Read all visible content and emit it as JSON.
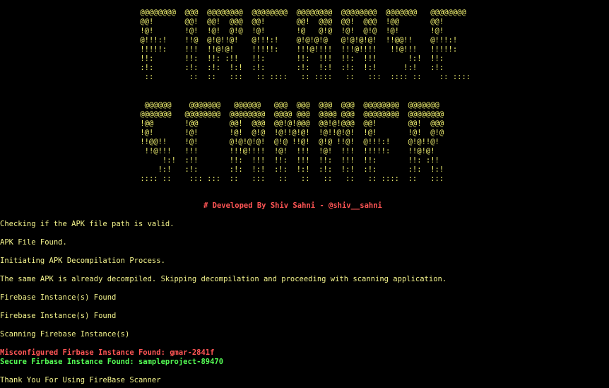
{
  "banner": {
    "block1": " @@@@@@@@  @@@  @@@@@@@@  @@@@@@@@  @@@@@@@@  @@@@@@@@  @@@@@@@   @@@@@@@@\n @@!       @@!  @@!  @@@  @@!       @@!  @@@  @@!  @@@  !@@       @@!\n !@!       !@!  !@!  @!@  !@!       !@   @!@  !@!  @!@  !@!       !@!\n @!!!:!    !!@  @!@!!@!   @!!!:!    @!@!@!@   @!@!@!@!  !!@@!!    @!!!:!\n !!!!!:    !!!  !!@!@!    !!!!!:    !!!@!!!!  !!!@!!!!   !!@!!!   !!!!!:\n !!:       !!:  !!: :!!   !!:       !!:  !!!  !!:  !!!       !:!  !!:\n :!:       :!:  :!:  !:!  :!:       :!:  !:!  :!:  !:!      !:!   :!:\n  ::        ::  ::   :::   :: ::::   :: ::::   ::   :::  :::: ::    :: ::::",
    "block2": "  @@@@@@    @@@@@@@   @@@@@@   @@@  @@@  @@@  @@@  @@@@@@@@  @@@@@@@\n @@@@@@@   @@@@@@@@  @@@@@@@@  @@@@ @@@  @@@@ @@@  @@@@@@@@  @@@@@@@@\n !@@       !@@       @@!  @@@  @@!@!@@@  @@!@!@@@  @@!       @@!  @@@\n !@!       !@!       !@!  @!@  !@!!@!@!  !@!!@!@!  !@!       !@!  @!@\n !!@@!!    !@!       @!@!@!@!  @!@ !!@!  @!@ !!@!  @!!!:!    @!@!!@!\n  !!@!!!   !!!       !!!@!!!!  !@!  !!!  !@!  !!!  !!!!!:    !!@!@!\n      !:!  :!!       !!:  !!!  !!:  !!!  !!:  !!!  !!:       !!: :!!\n     !:!   :!:       :!:  !:!  :!:  !:!  :!:  !:!  :!:       :!:  !:!\n :::: ::    ::: :::  ::   :::   ::   ::   ::   ::   :: ::::  ::   :::"
  },
  "developer_line": "# Developed By Shiv Sahni - @shiv__sahni",
  "log": [
    {
      "text": "Checking if the APK file path is valid.",
      "color": "#f4f48c"
    },
    {
      "text": "APK File Found.",
      "color": "#f4f48c"
    },
    {
      "text": "Initiating APK Decompilation Process.",
      "color": "#f4f48c"
    },
    {
      "text": "The same APK is already decompiled. Skipping decompilation and proceeding with scanning application.",
      "color": "#f4f48c"
    },
    {
      "text": "Firebase Instance(s) Found",
      "color": "#f4f48c"
    },
    {
      "text": "Firebase Instance(s) Found",
      "color": "#f4f48c"
    },
    {
      "text": "Scanning Firebase Instance(s)",
      "color": "#f4f48c"
    },
    {
      "text": "Misconfigured Firbase Instance Found: gmar-2841f",
      "color": "#ff5555"
    },
    {
      "text": "Secure Firbase Instance Found: sampleproject-89470",
      "color": "#55ff55"
    },
    {
      "text": "Thank You For Using FireBase Scanner",
      "color": "#f4f48c"
    }
  ]
}
